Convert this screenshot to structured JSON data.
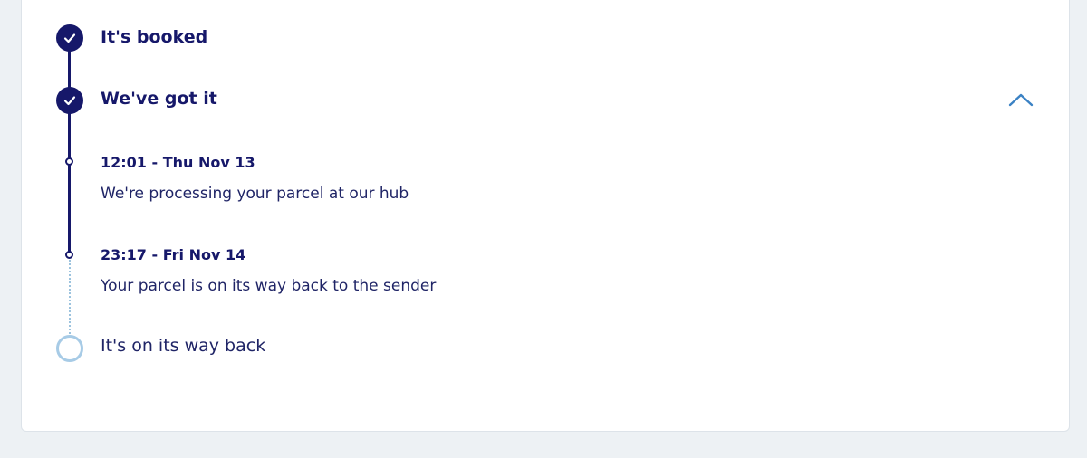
{
  "timeline": {
    "steps": [
      {
        "title": "It's booked",
        "status": "complete",
        "icon": "check-icon"
      },
      {
        "title": "We've got it",
        "status": "complete",
        "icon": "check-icon",
        "expanded": true,
        "events": [
          {
            "time": "12:01 - Thu Nov 13",
            "description": "We're processing your parcel at our hub"
          },
          {
            "time": "23:17 - Fri Nov 14",
            "description": "Your parcel is on its way back to the sender"
          }
        ]
      },
      {
        "title": "It's on its way back",
        "status": "pending",
        "icon": "open-circle-icon"
      }
    ],
    "collapse_icon": "chevron-up-icon"
  },
  "colors": {
    "navy": "#16186a",
    "light_blue": "#a7cbe6",
    "accent": "#3b82c4",
    "page_bg": "#edf1f4"
  }
}
